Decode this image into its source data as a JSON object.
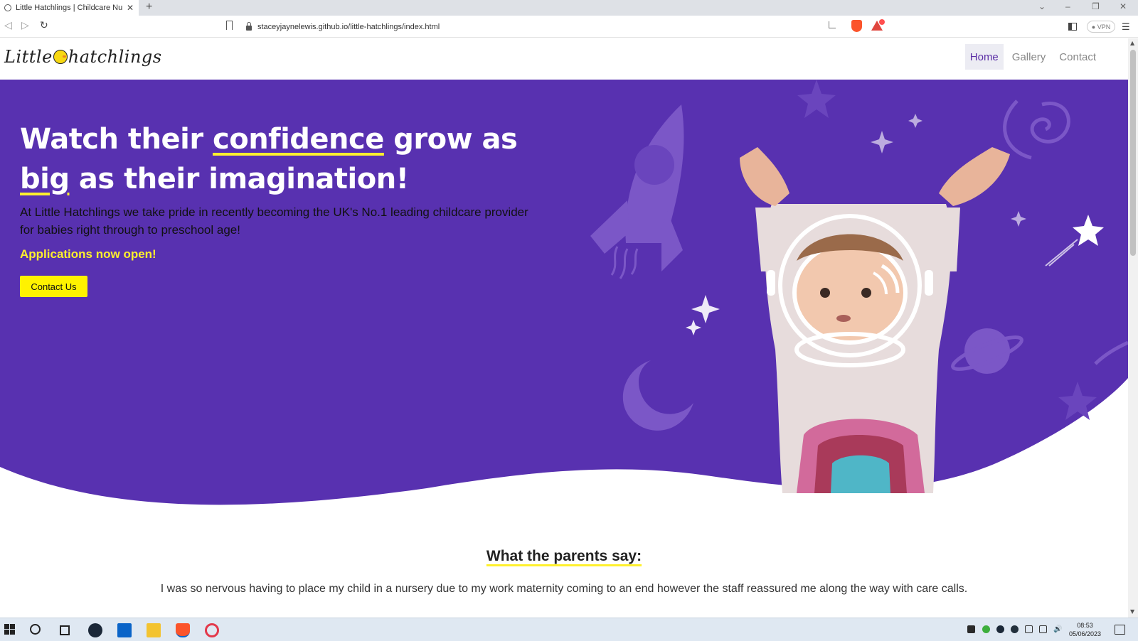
{
  "browser": {
    "tab_title": "Little Hatchlings | Childcare Nurse",
    "tab_close": "✕",
    "new_tab": "+",
    "url": "staceyjaynelewis.github.io/little-hatchlings/index.html",
    "vpn_label": "● VPN",
    "win_controls": [
      "⌄",
      "–",
      "❐",
      "✕"
    ]
  },
  "site": {
    "logo_left": "Little",
    "logo_right": "hatchlings",
    "nav": [
      {
        "label": "Home",
        "active": true
      },
      {
        "label": "Gallery",
        "active": false
      },
      {
        "label": "Contact",
        "active": false
      }
    ]
  },
  "hero": {
    "heading_1": "Watch their ",
    "heading_hl1": "confidence",
    "heading_2": " grow as ",
    "heading_hl2": "big",
    "heading_3": " as their imagination!",
    "text": "At Little Hatchlings we take pride in recently becoming the UK's No.1 leading childcare provider for babies right through to preschool age!",
    "applications": "Applications now open!",
    "cta": "Contact Us"
  },
  "testimonials": {
    "title": "What the parents say:",
    "quote": "I was so nervous having to place my child in a nursery due to my work maternity coming to an end however the staff reassured me along the way with care calls."
  },
  "taskbar": {
    "time": "08:53",
    "date": "05/06/2023"
  },
  "colors": {
    "hero_bg": "#5831b0",
    "accent_yellow": "#fff200",
    "nav_active": "#5b2ea6"
  }
}
